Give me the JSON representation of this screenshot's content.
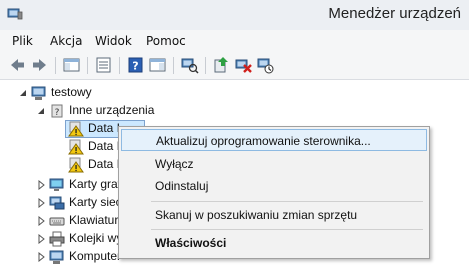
{
  "window": {
    "title": "Menedżer urządzeń",
    "app_icon": "device-manager-icon"
  },
  "menubar": {
    "items": [
      "Plik",
      "Akcja",
      "Widok",
      "Pomoc"
    ]
  },
  "toolbar": {
    "buttons": [
      "back-icon",
      "forward-icon",
      "show-hide-tree-icon",
      "properties-icon",
      "help-icon",
      "action-pane-icon",
      "scan-hardware-icon",
      "update-driver-icon",
      "uninstall-device-icon",
      "enable-device-icon"
    ]
  },
  "tree": {
    "root": "testowy",
    "other_devices": "Inne urządzenia",
    "devices": [
      "Data I",
      "Data I",
      "Data I"
    ],
    "categories": [
      "Karty graf",
      "Karty siec",
      "Klawiatur",
      "Kolejki wy",
      "Komputer"
    ]
  },
  "context_menu": {
    "items": [
      {
        "label": "Aktualizuj oprogramowanie sterownika...",
        "highlighted": true
      },
      {
        "label": "Wyłącz"
      },
      {
        "label": "Odinstaluj"
      },
      {
        "label": "Skanuj w poszukiwaniu zmian sprzętu"
      },
      {
        "label": "Właściwości",
        "bold": true
      }
    ]
  }
}
